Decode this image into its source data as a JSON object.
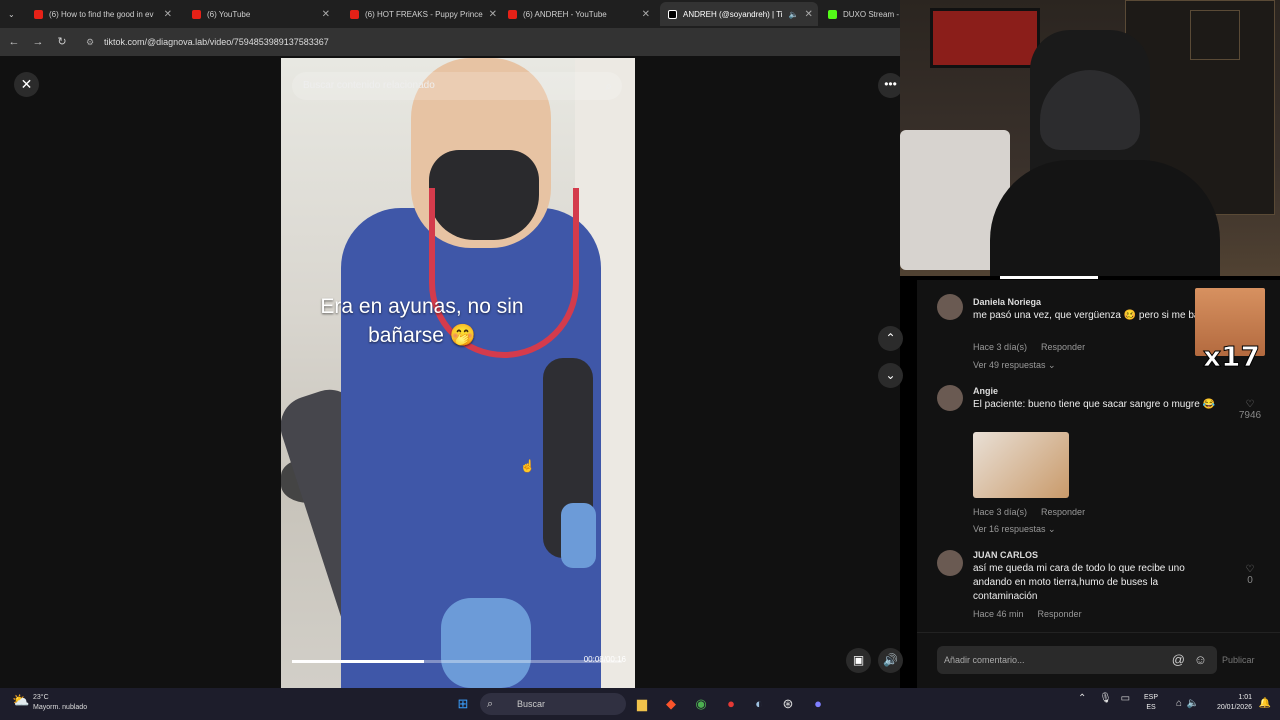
{
  "browser": {
    "tabs": [
      {
        "label": "(6) How to find the good in ev",
        "favicon": "youtube-icon"
      },
      {
        "label": "(6) YouTube",
        "favicon": "youtube-icon"
      },
      {
        "label": "(6) HOT FREAKS - Puppy Prince",
        "favicon": "youtube-icon"
      },
      {
        "label": "(6) ANDREH - YouTube",
        "favicon": "youtube-icon"
      },
      {
        "label": "ANDREH (@soyandreh) | Ti",
        "favicon": "tiktok-icon"
      },
      {
        "label": "DUXO Stream - ",
        "favicon": "kick-icon"
      }
    ],
    "url": "tiktok.com/@diagnova.lab/video/7594853989137583367"
  },
  "video": {
    "search_placeholder": "Buscar contenido relacionado",
    "caption": "Era en ayunas, no sin bañarse 🤭",
    "timecode": "00:08/00:16",
    "progress": 0.4
  },
  "comments": [
    {
      "name": "Daniela Noriega",
      "text": "me pasó una vez, que vergüenza 🥴 pero si me bañé",
      "time": "Hace 3 día(s)",
      "reply": "Responder",
      "replies": "Ver 49 respuestas ⌄",
      "likes": ""
    },
    {
      "name": "Angie",
      "text": "El paciente: bueno tiene que sacar sangre o mugre 😂",
      "time": "Hace 3 día(s)",
      "reply": "Responder",
      "replies": "Ver 16 respuestas ⌄",
      "likes": "7946"
    },
    {
      "name": "JUAN CARLOS",
      "text": "así me queda mi cara de todo lo que recibe uno andando en moto tierra,humo de buses la contaminación",
      "time": "Hace 46 min",
      "reply": "Responder",
      "replies": "",
      "likes": "0"
    }
  ],
  "overlay": {
    "multiplier": "x17"
  },
  "comment_box": {
    "placeholder": "Añadir comentario...",
    "publish": "Publicar"
  },
  "taskbar": {
    "weather_temp": "23°C",
    "weather_desc": "Mayorm. nublado",
    "search": "Buscar",
    "lang_top": "ESP",
    "lang_bottom": "ES",
    "time": "1:01",
    "date": "20/01/2026"
  }
}
